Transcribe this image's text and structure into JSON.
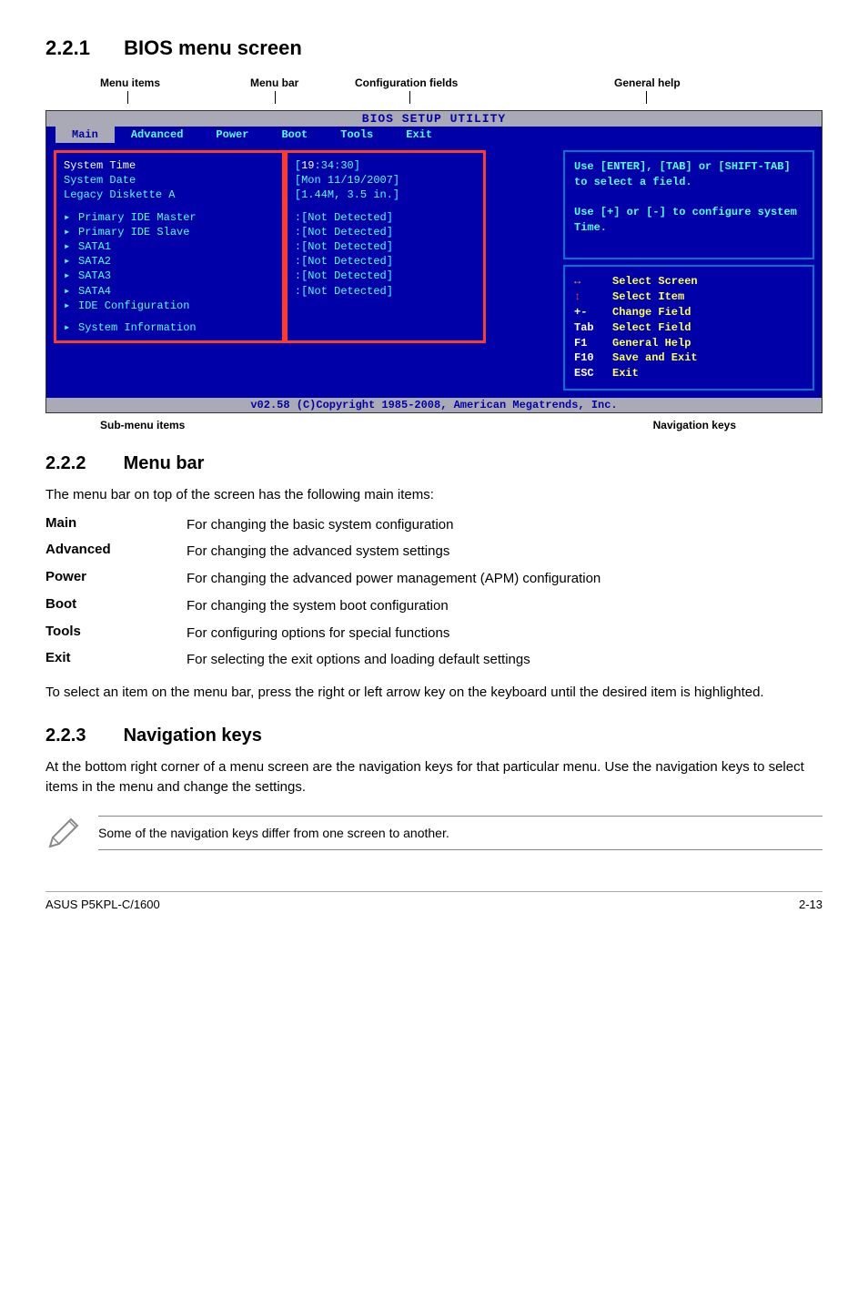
{
  "headings": {
    "h221_num": "2.2.1",
    "h221_title": "BIOS menu screen",
    "h222_num": "2.2.2",
    "h222_title": "Menu bar",
    "h223_num": "2.2.3",
    "h223_title": "Navigation keys"
  },
  "labels": {
    "menu_items": "Menu items",
    "menu_bar": "Menu bar",
    "config_fields": "Configuration fields",
    "general_help": "General help",
    "submenu_items": "Sub-menu items",
    "nav_keys": "Navigation keys"
  },
  "bios": {
    "title": "BIOS SETUP UTILITY",
    "tabs": [
      "Main",
      "Advanced",
      "Power",
      "Boot",
      "Tools",
      "Exit"
    ],
    "top_group": [
      {
        "label": "System Time",
        "value": "[19:34:30]",
        "white": true
      },
      {
        "label": "System Date",
        "value": "[Mon 11/19/2007]"
      },
      {
        "label": "Legacy Diskette A",
        "value": "[1.44M, 3.5 in.]"
      }
    ],
    "drives": [
      {
        "label": "Primary IDE Master",
        "value": ":[Not Detected]"
      },
      {
        "label": "Primary IDE Slave",
        "value": ":[Not Detected]"
      },
      {
        "label": "SATA1",
        "value": ":[Not Detected]"
      },
      {
        "label": "SATA2",
        "value": ":[Not Detected]"
      },
      {
        "label": "SATA3",
        "value": ":[Not Detected]"
      },
      {
        "label": "SATA4",
        "value": ":[Not Detected]"
      },
      {
        "label": "IDE Configuration",
        "value": ""
      }
    ],
    "sysinfo": "System Information",
    "help_text": "Use [ENTER], [TAB] or [SHIFT-TAB] to select a field.\n\nUse [+] or [-] to configure system Time.",
    "nav": [
      {
        "key": "↔",
        "desc": "Select Screen",
        "keyclass": "arrow-lr"
      },
      {
        "key": "↕",
        "desc": "Select Item",
        "keyclass": "arrow-ud"
      },
      {
        "key": "+-",
        "desc": "Change Field"
      },
      {
        "key": "Tab",
        "desc": "Select Field"
      },
      {
        "key": "F1",
        "desc": "General Help"
      },
      {
        "key": "F10",
        "desc": "Save and Exit"
      },
      {
        "key": "ESC",
        "desc": "Exit"
      }
    ],
    "footer": "v02.58 (C)Copyright 1985-2008, American Megatrends, Inc."
  },
  "menubar_intro": "The menu bar on top of the screen has the following main items:",
  "menubar_defs": [
    {
      "term": "Main",
      "desc": "For changing the basic system configuration"
    },
    {
      "term": "Advanced",
      "desc": "For changing the advanced system settings"
    },
    {
      "term": "Power",
      "desc": "For changing the advanced power management (APM) configuration"
    },
    {
      "term": "Boot",
      "desc": "For changing the system boot configuration"
    },
    {
      "term": "Tools",
      "desc": "For configuring options for special functions"
    },
    {
      "term": "Exit",
      "desc": "For selecting the exit options and loading default settings"
    }
  ],
  "menubar_footer": "To select an item on the menu bar, press the right or left arrow key on the keyboard until the desired item is highlighted.",
  "navkeys_text": "At the bottom right corner of a menu screen are the navigation keys for that particular menu. Use the navigation keys to select items in the menu and change the settings.",
  "note_text": "Some of the navigation keys differ from one screen to another.",
  "footer": {
    "left": "ASUS P5KPL-C/1600",
    "right": "2-13"
  }
}
